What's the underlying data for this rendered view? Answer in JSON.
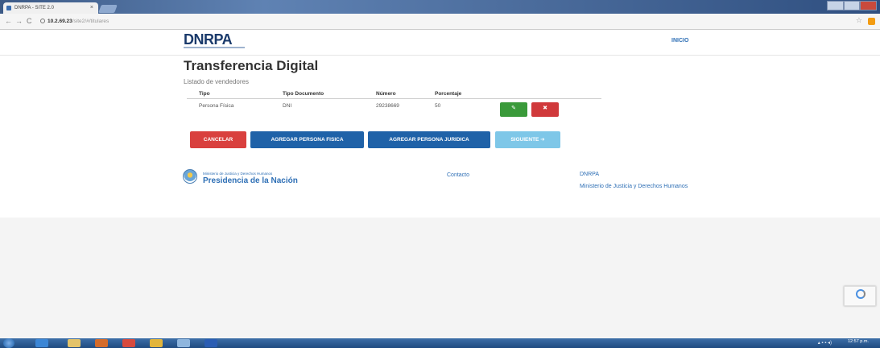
{
  "browser": {
    "tab_title": "DNRPA - SITE 2.0",
    "tab_close": "×",
    "nav_back": "←",
    "nav_forward": "→",
    "nav_reload": "C",
    "url_host": "10.2.69.23",
    "url_path": "/site2/#/titulares"
  },
  "header": {
    "logo": "DNRPA",
    "nav_inicio": "INICIO"
  },
  "main": {
    "title": "Transferencia Digital",
    "subtitle": "Listado de vendedores",
    "table": {
      "headers": [
        "Tipo",
        "Tipo Documento",
        "Número",
        "Porcentaje"
      ],
      "rows": [
        [
          "Persona Física",
          "DNI",
          "29238669",
          "50"
        ]
      ]
    },
    "row_edit_icon": "✎",
    "row_delete_icon": "✖",
    "buttons": {
      "cancel": "CANCELAR",
      "add_fisica": "AGREGAR PERSONA FISICA",
      "add_juridica": "AGREGAR PERSONA JURIDICA",
      "next": "SIGUIENTE ➔"
    }
  },
  "footer": {
    "ministerio_small": "Ministerio de Justicia y Derechos Humanos",
    "presidencia": "Presidencia de la Nación",
    "contacto": "Contacto",
    "dnrpa": "DNRPA",
    "ministerio": "Ministerio de Justicia y Derechos Humanos"
  },
  "taskbar": {
    "clock": "12:57 p.m."
  },
  "colors": {
    "brand": "#1a3a6b",
    "link": "#2e6fb5",
    "danger": "#d9403e",
    "primary": "#1f62a8",
    "success": "#3a9a3a",
    "info": "#7ec7e8"
  }
}
